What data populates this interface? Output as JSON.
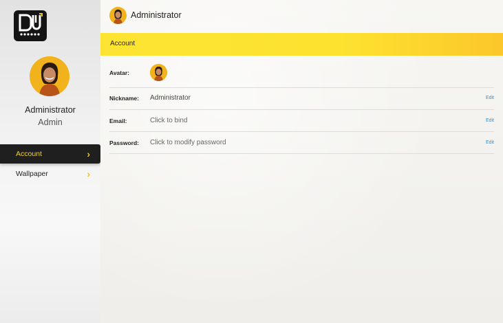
{
  "sidebar": {
    "profile": {
      "name": "Administrator",
      "role": "Admin",
      "avatar_icon": "user-portrait-icon"
    },
    "items": [
      {
        "label": "Account",
        "active": true,
        "icon": "chevron-right-icon"
      },
      {
        "label": "Wallpaper",
        "active": false,
        "icon": "chevron-right-icon"
      }
    ]
  },
  "header": {
    "title": "Administrator"
  },
  "section": {
    "title": "Account"
  },
  "account": {
    "avatar_label": "Avatar:",
    "nickname_label": "Nickname:",
    "nickname_value": "Administrator",
    "email_label": "Email:",
    "email_value": "Click to bind",
    "password_label": "Password:",
    "password_value": "Click to modify password",
    "edit_label": "Edit"
  },
  "colors": {
    "accent": "#fde233",
    "active_bg": "#1f1f1f",
    "link": "#3a8fd4"
  }
}
